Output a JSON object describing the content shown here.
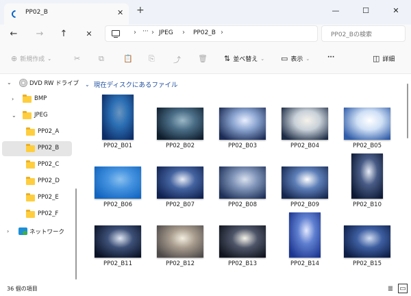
{
  "window": {
    "tab_title": "PP02_B",
    "new_tab": "+",
    "minimize": "—",
    "maximize": "☐",
    "close": "✕"
  },
  "nav": {
    "back": "←",
    "forward": "→",
    "up": "↑",
    "stop": "✕",
    "more": "···",
    "breadcrumbs": [
      "JPEG",
      "PP02_B"
    ],
    "search_placeholder": "PP02_Bの検索"
  },
  "toolbar": {
    "new": "新規作成",
    "sort": "並べ替え",
    "view": "表示",
    "more": "···",
    "details": "詳細"
  },
  "sidebar": {
    "drive": "DVD RW ドライブ",
    "items": [
      "BMP",
      "JPEG",
      "PP02_A",
      "PP02_B",
      "PP02_C",
      "PP02_D",
      "PP02_E",
      "PP02_F"
    ],
    "network": "ネットワーク",
    "selected": "PP02_B"
  },
  "main": {
    "section_title": "現在ディスクにあるファイル",
    "files": [
      {
        "name": "PP02_B01",
        "colors": [
          "#0c2c66",
          "#2b6fb4",
          "#6a95c0"
        ]
      },
      {
        "name": "PP02_B02",
        "colors": [
          "#0e1d2c",
          "#4a6d86",
          "#9ab7c6"
        ]
      },
      {
        "name": "PP02_B03",
        "colors": [
          "#1b2b55",
          "#8aa4d0",
          "#e9efff"
        ]
      },
      {
        "name": "PP02_B04",
        "colors": [
          "#1d2c45",
          "#c9d1d9",
          "#f5f2ea"
        ]
      },
      {
        "name": "PP02_B05",
        "colors": [
          "#2f5ca8",
          "#cfe0f6",
          "#ffffff"
        ]
      },
      {
        "name": "PP02_B06",
        "colors": [
          "#1265c0",
          "#4593e0",
          "#8ac0ee"
        ]
      },
      {
        "name": "PP02_B07",
        "colors": [
          "#0f2150",
          "#4463a0",
          "#e8ecf6"
        ]
      },
      {
        "name": "PP02_B08",
        "colors": [
          "#1e3058",
          "#7f93b8",
          "#d9e1ee"
        ]
      },
      {
        "name": "PP02_B09",
        "colors": [
          "#14264e",
          "#5d7eb8",
          "#ffffff"
        ]
      },
      {
        "name": "PP02_B10",
        "colors": [
          "#0c1834",
          "#495c86",
          "#e6ebf5"
        ]
      },
      {
        "name": "PP02_B11",
        "colors": [
          "#0a1226",
          "#3d5077",
          "#dfe6f3"
        ]
      },
      {
        "name": "PP02_B12",
        "colors": [
          "#4e4a4a",
          "#a79b8d",
          "#f3eee0"
        ]
      },
      {
        "name": "PP02_B13",
        "colors": [
          "#10141e",
          "#4e5568",
          "#f5f3ea"
        ]
      },
      {
        "name": "PP02_B14",
        "colors": [
          "#1c3590",
          "#5f7fd0",
          "#e3e9ff"
        ]
      },
      {
        "name": "PP02_B15",
        "colors": [
          "#0d1d44",
          "#3d5ea0",
          "#d0dcf2"
        ]
      }
    ]
  },
  "status": {
    "count": "36 個の項目",
    "view_list_icon": "≣",
    "view_grid_icon": "▭"
  }
}
